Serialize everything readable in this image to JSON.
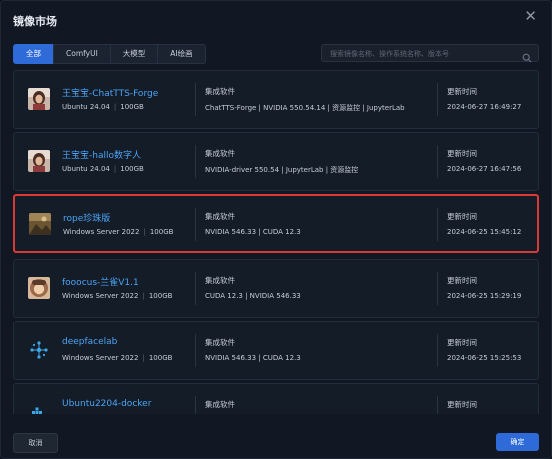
{
  "dialog": {
    "title": "镜像市场",
    "close_label": "✕"
  },
  "tabs": [
    {
      "label": "全部",
      "active": true
    },
    {
      "label": "ComfyUI",
      "active": false
    },
    {
      "label": "大模型",
      "active": false
    },
    {
      "label": "AI绘画",
      "active": false
    }
  ],
  "search": {
    "placeholder": "搜索镜像名称、操作系统名称、版本号",
    "value": ""
  },
  "columns": {
    "software": "集成软件",
    "updated": "更新时间"
  },
  "images": [
    {
      "name": "王宝宝-ChatTTS-Forge",
      "os": "Ubuntu 24.04",
      "size": "100GB",
      "software": "ChatTTS-Forge | NVIDIA 550.54.14 | 资源监控 | JupyterLab",
      "updated": "2024-06-27 16:49:27",
      "icon": "portrait-thumbnail",
      "selected": false
    },
    {
      "name": "王宝宝-hallo数字人",
      "os": "Ubuntu 24.04",
      "size": "100GB",
      "software": "NVIDIA-driver 550.54 | JupyterLab | 资源监控",
      "updated": "2024-06-27 16:47:56",
      "icon": "portrait-thumbnail",
      "selected": false
    },
    {
      "name": "rope珍珠版",
      "os": "Windows Server 2022",
      "size": "100GB",
      "software": "NVIDIA 546.33 | CUDA 12.3",
      "updated": "2024-06-25 15:45:12",
      "icon": "photo-thumbnail",
      "selected": true
    },
    {
      "name": "fooocus-兰雀V1.1",
      "os": "Windows Server 2022",
      "size": "100GB",
      "software": "CUDA 12.3 | NVIDIA 546.33",
      "updated": "2024-06-25 15:29:19",
      "icon": "avatar-thumbnail",
      "selected": false
    },
    {
      "name": "deepfacelab",
      "os": "Windows Server 2022",
      "size": "100GB",
      "software": "NVIDIA 546.33 | CUDA 12.3",
      "updated": "2024-06-25 15:25:53",
      "icon": "network-icon",
      "selected": false
    },
    {
      "name": "Ubuntu2204-docker",
      "os": "",
      "size": "",
      "software": "",
      "updated": "",
      "icon": "docker-icon",
      "selected": false
    }
  ],
  "footer": {
    "cancel_label": "取消",
    "ok_label": "确定"
  },
  "colors": {
    "accent": "#2e6bd8",
    "link": "#4ba3f5",
    "selected_border": "#d93a35",
    "background": "#111823"
  }
}
